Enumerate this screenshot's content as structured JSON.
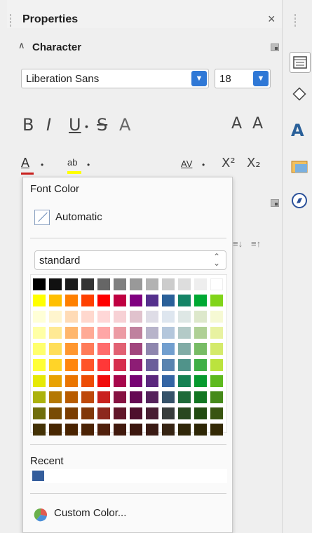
{
  "panel": {
    "title": "Properties",
    "close_glyph": "×",
    "section_title": "Character",
    "section_chevron": "∧",
    "font_name": "Liberation Sans",
    "font_size": "18",
    "bold": "B",
    "italic": "I",
    "underline": "U",
    "strikethrough": "S",
    "shadow": "A",
    "grow_font": "A",
    "shrink_font": "A",
    "spacing": "AV",
    "superscript": "X²",
    "subscript": "X₂"
  },
  "popup": {
    "title": "Font Color",
    "automatic_label": "Automatic",
    "palette": "standard",
    "recent_label": "Recent",
    "recent_colors": [
      "#355e9c"
    ],
    "custom_label": "Custom Color...",
    "colors": [
      [
        "#000000",
        "#111111",
        "#1c1c1c",
        "#333333",
        "#666666",
        "#808080",
        "#999999",
        "#b2b2b2",
        "#cccccc",
        "#dddddd",
        "#eeeeee",
        "#ffffff"
      ],
      [
        "#ffff00",
        "#ffbf00",
        "#ff8000",
        "#ff4000",
        "#ff0000",
        "#bf0041",
        "#800080",
        "#55308d",
        "#2a6099",
        "#158466",
        "#00a933",
        "#81d41a"
      ],
      [
        "#ffffd7",
        "#fff5ce",
        "#ffdbb6",
        "#ffd8ce",
        "#ffd7d7",
        "#f7d1d5",
        "#e0c2cd",
        "#dedce6",
        "#dee6ef",
        "#dee7e5",
        "#dde8cb",
        "#f6f9d4"
      ],
      [
        "#ffffa6",
        "#ffe994",
        "#ffb66c",
        "#ffaa95",
        "#ffa6a6",
        "#ec9ba4",
        "#bf819e",
        "#b7b3ca",
        "#b4c7dc",
        "#b3cac7",
        "#afd095",
        "#e8f2a1"
      ],
      [
        "#ffff6d",
        "#ffde59",
        "#ff972f",
        "#ff7b59",
        "#ff6d6d",
        "#e16173",
        "#a1467e",
        "#8e86ae",
        "#729fcf",
        "#81aca6",
        "#77bc65",
        "#d4ea6b"
      ],
      [
        "#ffff38",
        "#ffd428",
        "#ff860d",
        "#ff5429",
        "#ff3838",
        "#d62e4e",
        "#8d1d75",
        "#6b5e9b",
        "#5983b0",
        "#50938a",
        "#3faf46",
        "#bbe33d"
      ],
      [
        "#e6e905",
        "#e8a202",
        "#ea7500",
        "#ed4c05",
        "#f10d0c",
        "#a7074b",
        "#780373",
        "#5b277d",
        "#3465a4",
        "#168253",
        "#069a2e",
        "#5eb91e"
      ],
      [
        "#acb20c",
        "#b47804",
        "#b85c00",
        "#be480a",
        "#c9211e",
        "#861141",
        "#650953",
        "#55215b",
        "#355269",
        "#1e6a39",
        "#127622",
        "#468a1a"
      ],
      [
        "#706e0c",
        "#784b04",
        "#7b3d00",
        "#813709",
        "#8d281e",
        "#611729",
        "#4e102d",
        "#481d32",
        "#383d3c",
        "#28471f",
        "#224b12",
        "#395511"
      ],
      [
        "#443205",
        "#472702",
        "#492300",
        "#4b2204",
        "#50200c",
        "#41190d",
        "#3b160e",
        "#3a1a14",
        "#362413",
        "#302709",
        "#2e2706",
        "#342a06"
      ]
    ]
  },
  "sidebar": {
    "buttons": [
      "properties-icon",
      "shapes-icon",
      "styles-icon",
      "gallery-icon",
      "navigator-icon"
    ]
  }
}
